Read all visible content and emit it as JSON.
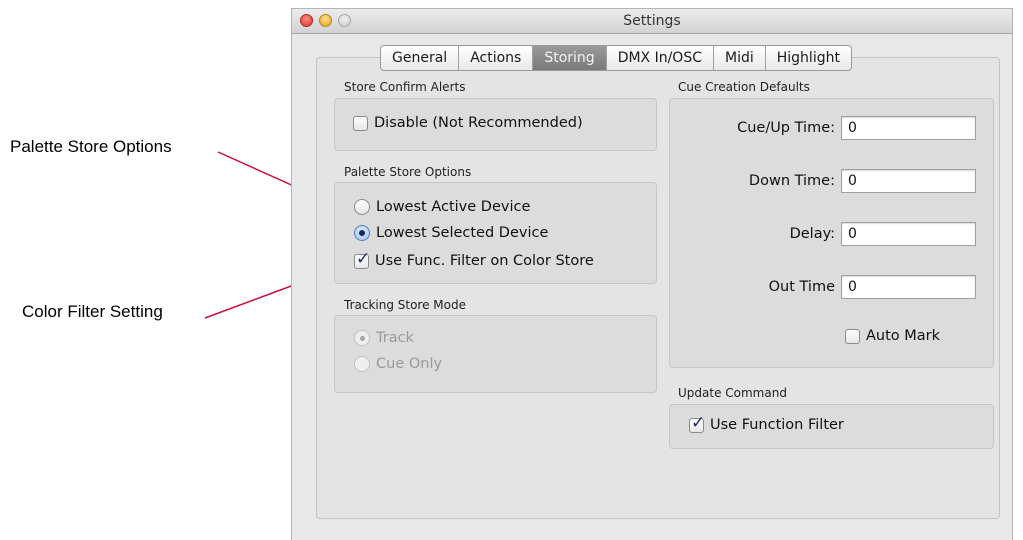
{
  "annotations": {
    "palette": "Palette Store Options",
    "color_filter": "Color Filter Setting"
  },
  "window": {
    "title": "Settings"
  },
  "tabs": [
    {
      "label": "General"
    },
    {
      "label": "Actions"
    },
    {
      "label": "Storing",
      "selected": true
    },
    {
      "label": "DMX In/OSC"
    },
    {
      "label": "Midi"
    },
    {
      "label": "Highlight"
    }
  ],
  "store_confirm": {
    "title": "Store Confirm Alerts",
    "disable_label": "Disable (Not Recommended)",
    "disable_checked": false
  },
  "palette_store": {
    "title": "Palette Store Options",
    "options": [
      {
        "label": "Lowest Active Device",
        "selected": false
      },
      {
        "label": "Lowest Selected Device",
        "selected": true
      }
    ],
    "func_filter_label": "Use Func. Filter on Color Store",
    "func_filter_checked": true
  },
  "tracking": {
    "title": "Tracking Store Mode",
    "options": [
      {
        "label": "Track",
        "selected": true
      },
      {
        "label": "Cue Only",
        "selected": false
      }
    ]
  },
  "cue_defaults": {
    "title": "Cue Creation Defaults",
    "fields": [
      {
        "label": "Cue/Up Time:",
        "value": "0"
      },
      {
        "label": "Down Time:",
        "value": "0"
      },
      {
        "label": "Delay:",
        "value": "0"
      },
      {
        "label": "Out Time",
        "value": "0"
      }
    ],
    "auto_mark_label": "Auto Mark",
    "auto_mark_checked": false
  },
  "update_command": {
    "title": "Update Command",
    "func_filter_label": "Use Function Filter",
    "func_filter_checked": true
  },
  "colors": {
    "arrow": "#c8103e",
    "selected_tab": "#8a8a8a"
  }
}
